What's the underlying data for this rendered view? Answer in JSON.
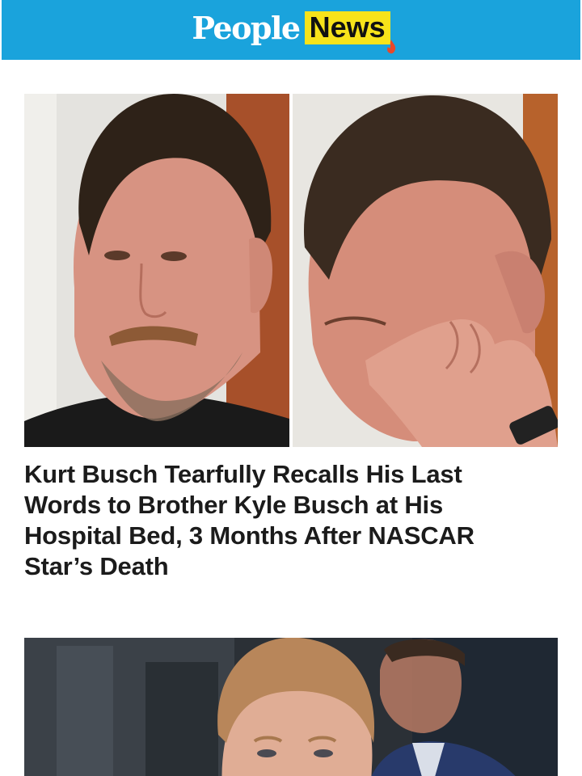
{
  "header": {
    "logo_people": "People",
    "logo_news": "News",
    "colors": {
      "bar": "#1aa3dc",
      "news_highlight": "#f7e31a"
    }
  },
  "stories": [
    {
      "headline": "Kurt Busch Tearfully Recalls His Last Words to Brother Kyle Busch at His Hospital Bed, 3 Months After NASCAR Star’s Death",
      "images": [
        "man-looking-forward-photo",
        "man-wiping-tear-photo"
      ]
    },
    {
      "headline": "",
      "images": [
        "man-with-red-hair-photo"
      ]
    }
  ]
}
